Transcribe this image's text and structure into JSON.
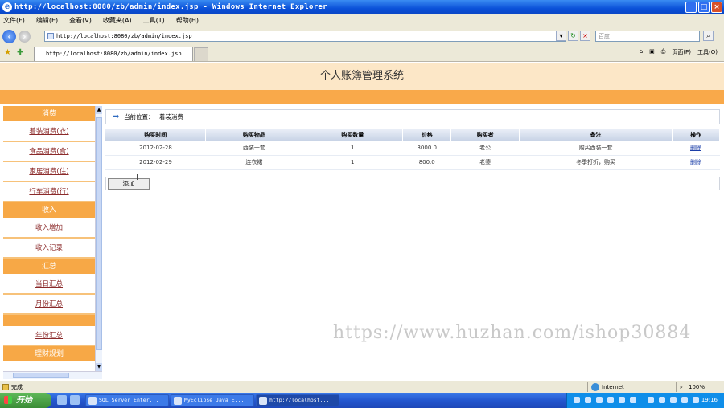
{
  "window": {
    "title": "http://localhost:8080/zb/admin/index.jsp - Windows Internet Explorer",
    "minimize": "_",
    "maximize": "□",
    "close": "×"
  },
  "menu": [
    "文件(F)",
    "编辑(E)",
    "查看(V)",
    "收藏夹(A)",
    "工具(T)",
    "帮助(H)"
  ],
  "address": {
    "url": "http://localhost:8080/zb/admin/index.jsp",
    "search_placeholder": "百度"
  },
  "tabs": {
    "active_tab": "http://localhost:8080/zb/admin/index.jsp"
  },
  "toolbar_right": [
    "页面(P)",
    "工具(O)"
  ],
  "app": {
    "title": "个人账簿管理系统"
  },
  "sidebar": {
    "sections": [
      {
        "header": "消费",
        "items": [
          "着装消费(衣)",
          "食品消费(食)",
          "家居消费(住)",
          "行车消费(行)"
        ]
      },
      {
        "header": "收入",
        "items": [
          "收入增加",
          "收入记录"
        ]
      },
      {
        "header": "汇总",
        "items": [
          "当日汇总",
          "月份汇总"
        ]
      },
      {
        "header": "",
        "items": [
          "年份汇总"
        ]
      },
      {
        "header": "理财规划",
        "items": []
      }
    ]
  },
  "breadcrumb": {
    "label": "当前位置：",
    "value": "着装消费"
  },
  "table": {
    "headers": [
      "购买时间",
      "购买物品",
      "购买数量",
      "价格",
      "购买者",
      "备注",
      "操作"
    ],
    "rows": [
      [
        "2012-02-28",
        "西装一套",
        "1",
        "3000.0",
        "老公",
        "购买西装一套",
        "删除"
      ],
      [
        "2012-02-29",
        "连衣裙",
        "1",
        "800.0",
        "老婆",
        "冬季打折，购买",
        "删除"
      ]
    ]
  },
  "add_button": "添加",
  "watermark": "https://www.huzhan.com/ishop30884",
  "status": {
    "left": "完成",
    "zone": "Internet",
    "zoom": "100%"
  },
  "taskbar": {
    "start": "开始",
    "tasks": [
      "SQL Server Enter...",
      "MyEclipse Java E...",
      "http://localhost..."
    ],
    "clock": "19:16"
  }
}
